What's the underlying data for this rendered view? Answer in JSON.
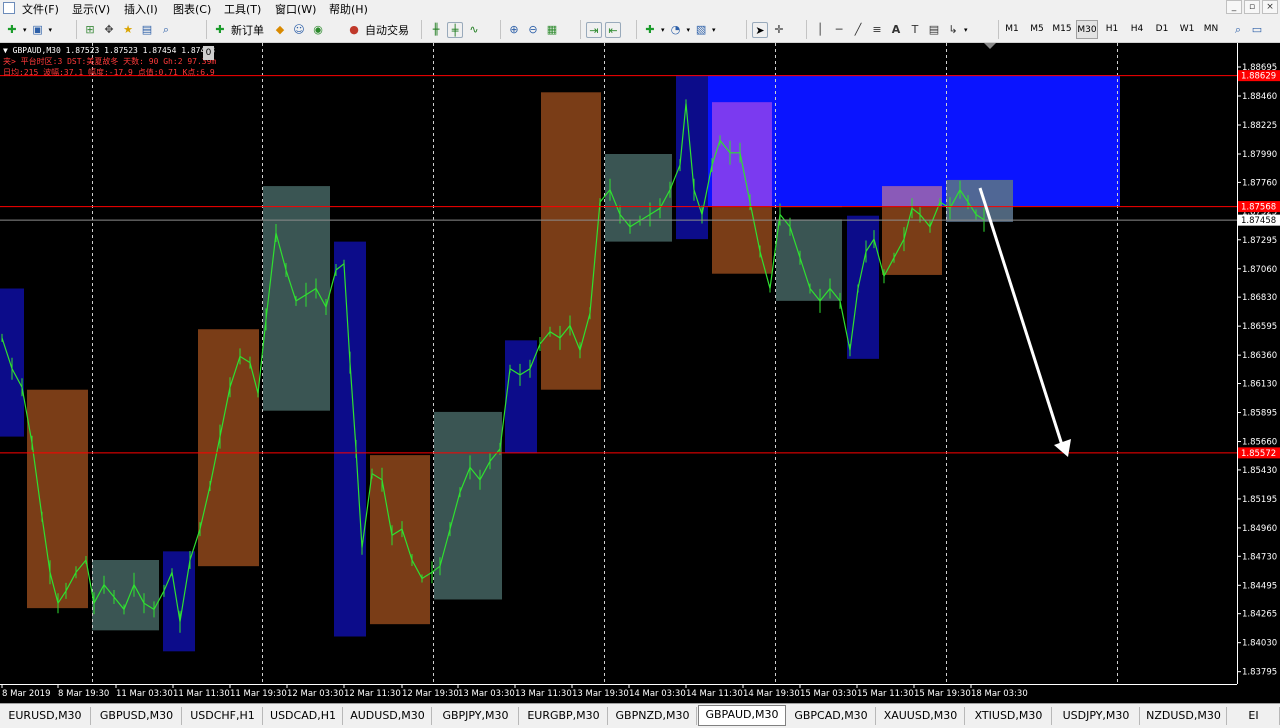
{
  "menu": {
    "items": [
      "文件(F)",
      "显示(V)",
      "插入(I)",
      "图表(C)",
      "工具(T)",
      "窗口(W)",
      "帮助(H)"
    ]
  },
  "toolbar": {
    "new_order_label": "新订单",
    "auto_trading_label": "自动交易",
    "timeframes": [
      "M1",
      "M5",
      "M15",
      "M30",
      "H1",
      "H4",
      "D1",
      "W1",
      "MN"
    ],
    "active_timeframe": "M30",
    "icons": [
      "new-chart-icon",
      "profiles-icon",
      "navigator-icon",
      "crosshair-icon",
      "market-watch-icon",
      "data-window-icon",
      "tester-icon",
      "new-order-icon",
      "metaeditor-icon",
      "expert-icon",
      "auto-trading-icon",
      "bar-chart-icon",
      "candle-icon",
      "line-icon",
      "zoom-in-icon",
      "zoom-out-icon",
      "tile-icon",
      "autoscroll-icon",
      "chart-shift-icon",
      "indicators-icon",
      "periods-icon",
      "templates-icon",
      "cursor-icon",
      "crosshair-tool-icon",
      "vertical-line-icon",
      "horizontal-line-icon",
      "trendline-icon",
      "channel-icon",
      "text-icon",
      "label-icon",
      "arrows-icon",
      "search-icon"
    ]
  },
  "chart": {
    "info_line1": "▼ GBPAUD,M30  1.87523 1.87523 1.87454 1.87458",
    "info_line2": "夹> 平台时区:3  DST:美夏故冬  天数: 90  Gh:2  97.39m",
    "info_line3": "日均:215  波幅:37.1  幅度:-17.9  点值:0.71  K点:6.9",
    "info_badge": "0",
    "price_labels": [
      "1.88695",
      "1.88460",
      "1.88225",
      "1.87990",
      "1.87760",
      "1.87525",
      "1.87295",
      "1.87060",
      "1.86830",
      "1.86595",
      "1.86360",
      "1.86130",
      "1.85895",
      "1.85660",
      "1.85430",
      "1.85195",
      "1.84960",
      "1.84730",
      "1.84495",
      "1.84265",
      "1.84030",
      "1.83795"
    ],
    "price_markers": [
      {
        "value": "1.88629",
        "color": "#ff0000"
      },
      {
        "value": "1.87568",
        "color": "#ff0000"
      },
      {
        "value": "1.87458",
        "color": "#ffffff"
      },
      {
        "value": "1.85572",
        "color": "#ff0000"
      }
    ],
    "time_labels": [
      "8 Mar 2019",
      "8 Mar 19:30",
      "11 Mar 03:30",
      "11 Mar 11:30",
      "11 Mar 19:30",
      "12 Mar 03:30",
      "12 Mar 11:30",
      "12 Mar 19:30",
      "13 Mar 03:30",
      "13 Mar 11:30",
      "13 Mar 19:30",
      "14 Mar 03:30",
      "14 Mar 11:30",
      "14 Mar 19:30",
      "15 Mar 03:30",
      "15 Mar 11:30",
      "15 Mar 19:30",
      "18 Mar 03:30"
    ],
    "colors": {
      "background": "#000000",
      "candles": "#2fe030",
      "session_orange": "#7a3d17",
      "session_gray": "#3a5553",
      "session_navy": "#0c0c8a",
      "zone_blue": "#0a14ff",
      "zone_purple": "#7b3af0",
      "zone_gray_light": "#58708a",
      "level_line": "#ff0000",
      "bid_line": "#8c8c8c",
      "arrow": "#ffffff"
    }
  },
  "tabs": {
    "items": [
      "EURUSD,M30",
      "GBPUSD,M30",
      "USDCHF,H1",
      "USDCAD,H1",
      "AUDUSD,M30",
      "GBPJPY,M30",
      "EURGBP,M30",
      "GBPNZD,M30",
      "GBPAUD,M30",
      "GBPCAD,M30",
      "XAUUSD,M30",
      "XTIUSD,M30",
      "USDJPY,M30",
      "NZDUSD,M30",
      "EI"
    ],
    "active_index": 8
  }
}
